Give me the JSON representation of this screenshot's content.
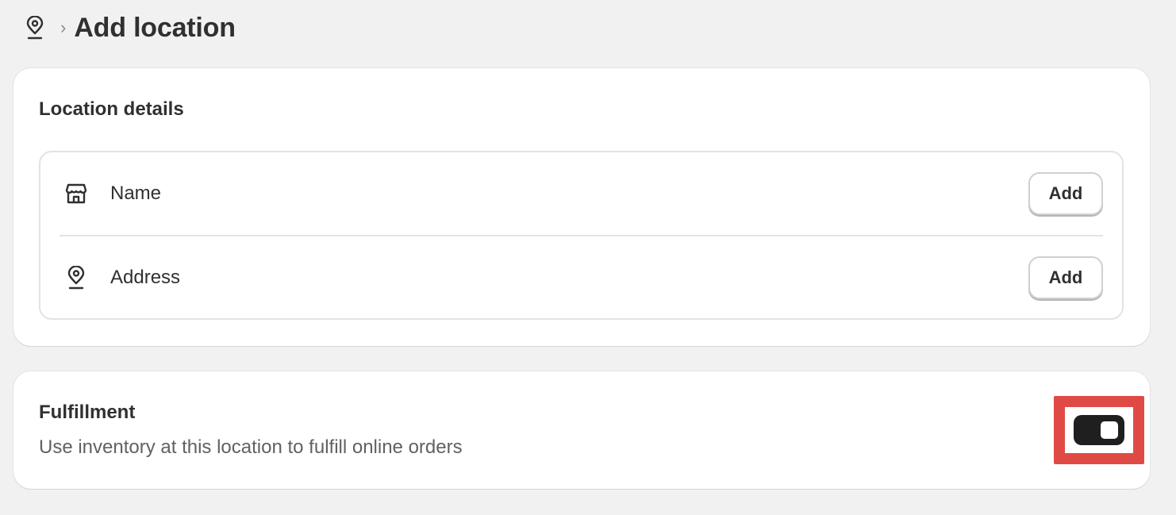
{
  "header": {
    "icon": "location-pin-icon",
    "separator": "›",
    "title": "Add location"
  },
  "location_details": {
    "title": "Location details",
    "rows": [
      {
        "icon": "store-icon",
        "label": "Name",
        "button": "Add"
      },
      {
        "icon": "location-pin-icon",
        "label": "Address",
        "button": "Add"
      }
    ]
  },
  "fulfillment": {
    "title": "Fulfillment",
    "description": "Use inventory at this location to fulfill online orders",
    "toggle_on": true
  },
  "colors": {
    "background": "#f1f1f1",
    "card": "#ffffff",
    "toggle_on": "#1f1f1f",
    "highlight": "#e04a44"
  }
}
